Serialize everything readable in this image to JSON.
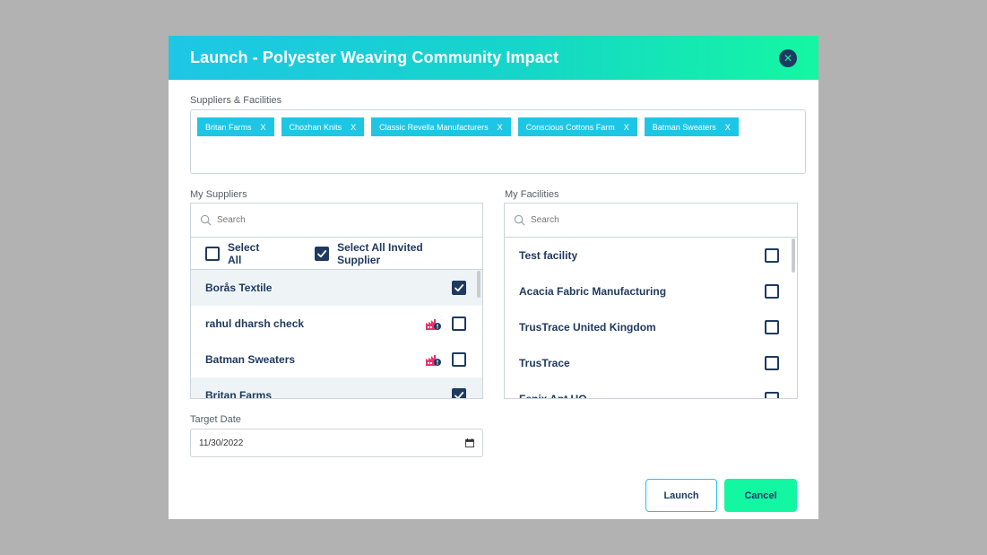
{
  "modal": {
    "title": "Launch - Polyester Weaving Community Impact",
    "close_icon": "close-icon"
  },
  "suppliers_facilities": {
    "label": "Suppliers & Facilities",
    "tags": [
      {
        "label": "Britan Farms",
        "remove": "X"
      },
      {
        "label": "Chozhan Knits",
        "remove": "X"
      },
      {
        "label": "Classic Revella Manufacturers",
        "remove": "X"
      },
      {
        "label": "Conscious Cottons Farm",
        "remove": "X"
      },
      {
        "label": "Batman Sweaters",
        "remove": "X"
      }
    ]
  },
  "my_suppliers": {
    "label": "My Suppliers",
    "search_placeholder": "Search",
    "select_all_label": "Select All",
    "select_all_checked": false,
    "select_all_invited_label": "Select All Invited Supplier",
    "select_all_invited_checked": true,
    "rows": [
      {
        "name": "Borås Textile",
        "checked": true,
        "facility_alert": false
      },
      {
        "name": "rahul dharsh check",
        "checked": false,
        "facility_alert": true
      },
      {
        "name": "Batman Sweaters",
        "checked": false,
        "facility_alert": true
      },
      {
        "name": "Britan Farms",
        "checked": true,
        "facility_alert": false
      }
    ]
  },
  "my_facilities": {
    "label": "My Facilities",
    "search_placeholder": "Search",
    "rows": [
      {
        "name": "Test facility",
        "checked": false
      },
      {
        "name": "Acacia Fabric Manufacturing",
        "checked": false
      },
      {
        "name": "TrusTrace United Kingdom",
        "checked": false
      },
      {
        "name": "TrusTrace",
        "checked": false
      },
      {
        "name": "Fenix Apt UO",
        "checked": false
      }
    ]
  },
  "target_date": {
    "label": "Target Date",
    "value": "11/30/2022"
  },
  "buttons": {
    "launch": "Launch",
    "cancel": "Cancel"
  },
  "colors": {
    "accent_cyan": "#1ec6e6",
    "accent_green": "#14f7a2",
    "navy": "#1f3a60",
    "alert_pink": "#e8336b"
  }
}
